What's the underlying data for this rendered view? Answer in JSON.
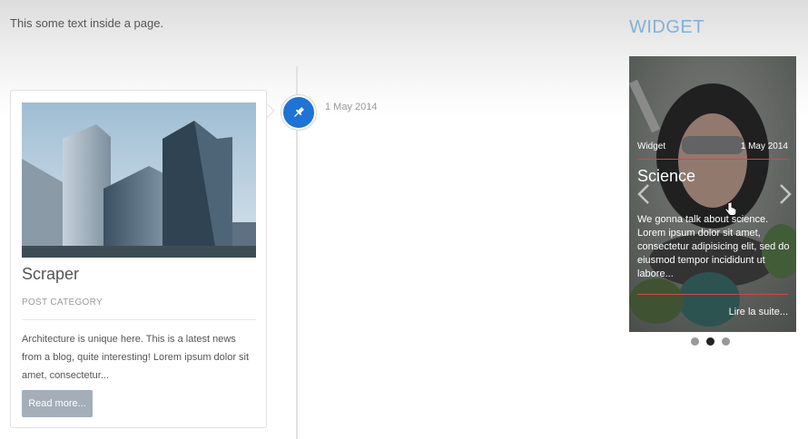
{
  "intro_text": "This some text inside a page.",
  "timeline": {
    "date": "1 May 2014",
    "pin_icon": "pushpin-icon",
    "accent_color": "#1e73d6"
  },
  "post": {
    "title": "Scraper",
    "category": "POST CATEGORY",
    "excerpt": "Architecture is unique here. This is a latest news from a blog, quite interesting! Lorem ipsum dolor sit amet, consectetur...",
    "read_more_label": "Read more..."
  },
  "widget": {
    "title": "WIDGET",
    "title_color": "#7fb3d6",
    "slide": {
      "category": "Widget",
      "date": "1 May 2014",
      "heading": "Science",
      "body": "We gonna talk about science. Lorem ipsum dolor sit amet, consectetur adipisicing elit, sed do eiusmod tempor incididunt ut labore...",
      "link_label": "Lire la suite...",
      "rule_color": "#d64545"
    },
    "dots": [
      "slide-1",
      "slide-2",
      "slide-3"
    ],
    "active_dot_index": 1
  }
}
